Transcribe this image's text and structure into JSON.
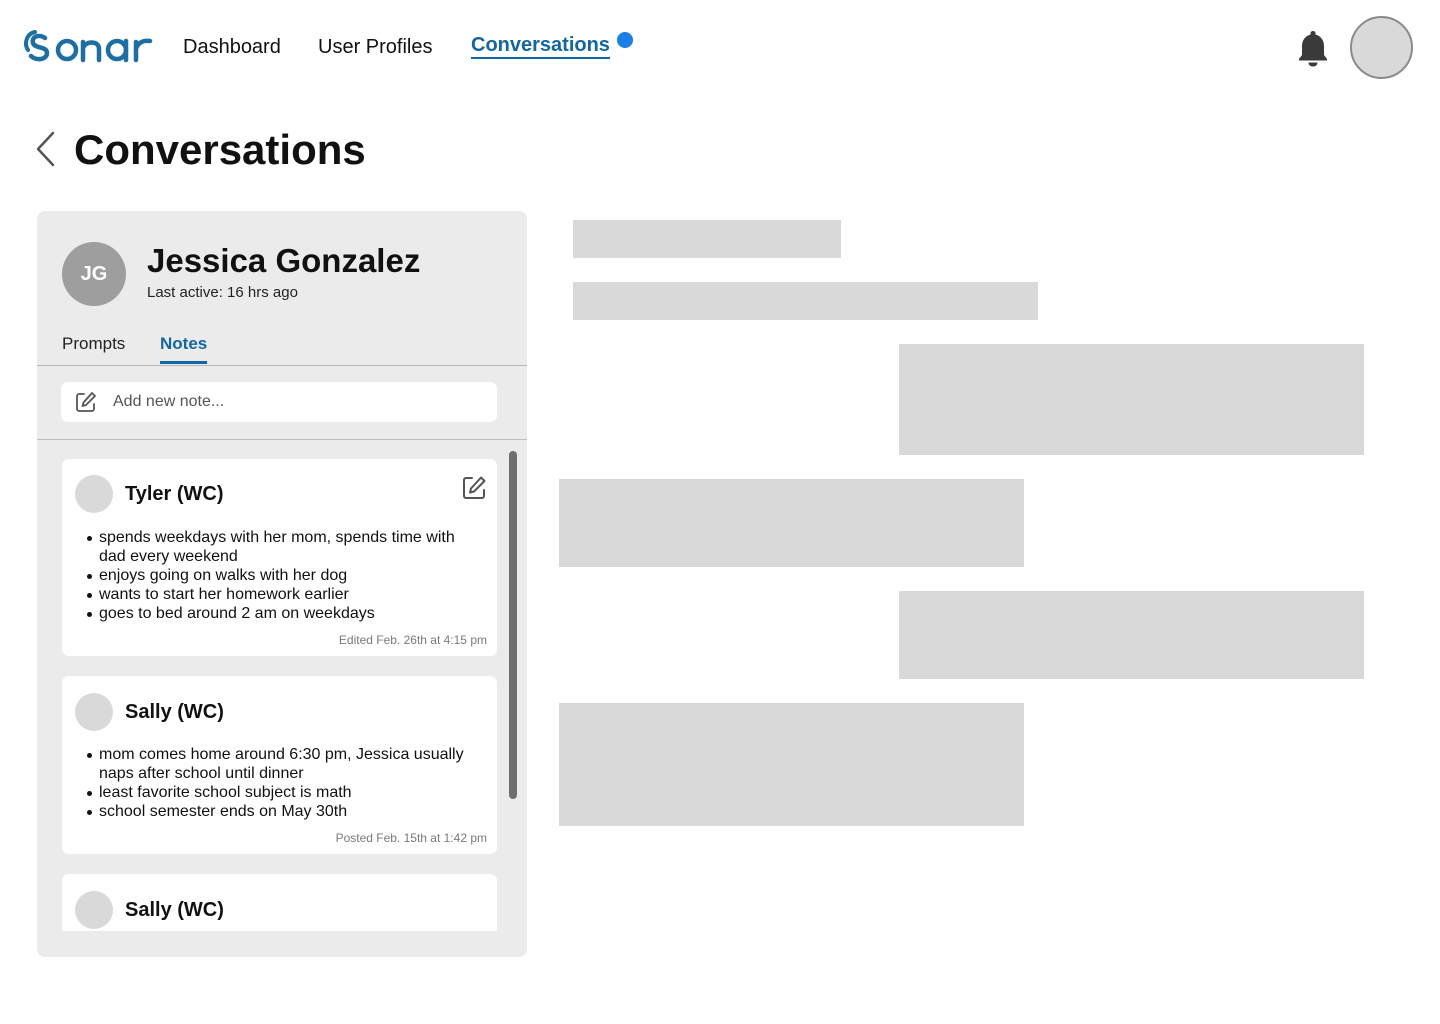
{
  "brand": {
    "logo_text": "sonar",
    "accent": "#1166a6",
    "notify_dot": "#1a7ee6"
  },
  "nav": {
    "links": [
      {
        "label": "Dashboard"
      },
      {
        "label": "User Profiles"
      },
      {
        "label": "Conversations",
        "active": true,
        "has_notification": true
      }
    ],
    "icons": {
      "notifications": "bell-icon",
      "user": "avatar"
    }
  },
  "page": {
    "title": "Conversations",
    "back_icon": "chevron-left-icon"
  },
  "profile": {
    "initials": "JG",
    "name": "Jessica Gonzalez",
    "last_active": "Last active: 16 hrs ago"
  },
  "tabs": [
    {
      "label": "Prompts",
      "active": false
    },
    {
      "label": "Notes",
      "active": true
    }
  ],
  "note_input": {
    "placeholder": "Add new note...",
    "icon": "edit-icon"
  },
  "notes": [
    {
      "author": "Tyler (WC)",
      "items": [
        "spends weekdays with her mom, spends time with dad every weekend",
        "enjoys going on walks with her dog",
        "wants to start her homework earlier",
        "goes to bed around 2 am on weekdays"
      ],
      "meta": "Edited Feb. 26th at 4:15 pm",
      "editable": true
    },
    {
      "author": "Sally (WC)",
      "items": [
        "mom comes home around 6:30 pm, Jessica usually naps after school until dinner",
        "least favorite school subject is math",
        "school semester ends on May 30th"
      ],
      "meta": "Posted Feb. 15th at 1:42 pm",
      "editable": false
    },
    {
      "author": "Sally (WC)",
      "items": [],
      "meta": "",
      "editable": false
    }
  ]
}
